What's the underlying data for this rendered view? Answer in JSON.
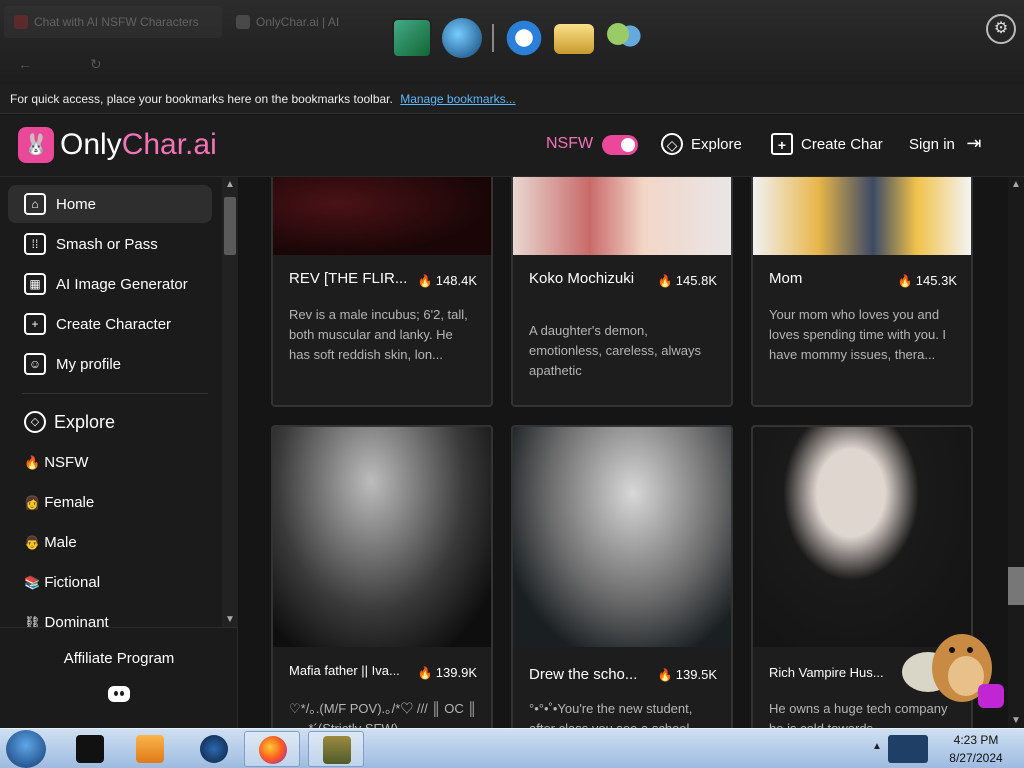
{
  "browser": {
    "tabs": [
      {
        "label": "Chat with AI NSFW Characters"
      },
      {
        "label": "OnlyChar.ai | AI"
      }
    ],
    "bookmarks_bar": {
      "text": "For quick access, place your bookmarks here on the bookmarks toolbar.",
      "link": "Manage bookmarks..."
    }
  },
  "header": {
    "logo_prefix": "Only",
    "logo_accent": "Char.ai",
    "nsfw_label": "NSFW",
    "nsfw_enabled": true,
    "explore": "Explore",
    "create_char": "Create Char",
    "sign_in": "Sign in"
  },
  "sidebar": {
    "items": [
      {
        "label": "Home",
        "icon": "home-icon"
      },
      {
        "label": "Smash or Pass",
        "icon": "grid-icon"
      },
      {
        "label": "AI Image Generator",
        "icon": "image-icon"
      },
      {
        "label": "Create Character",
        "icon": "plus-icon"
      },
      {
        "label": "My profile",
        "icon": "user-icon"
      }
    ],
    "explore_title": "Explore",
    "categories": [
      {
        "emoji": "🔥",
        "label": "NSFW"
      },
      {
        "emoji": "👩",
        "label": "Female"
      },
      {
        "emoji": "👨",
        "label": "Male"
      },
      {
        "emoji": "📚",
        "label": "Fictional"
      },
      {
        "emoji": "⛓",
        "label": "Dominant"
      }
    ],
    "affiliate": "Affiliate Program"
  },
  "cards": [
    {
      "title": "REV [THE FLIR...",
      "count": "148.4K",
      "desc": "Rev is a male incubus; 6'2, tall, both muscular and lanky. He has soft reddish skin, lon..."
    },
    {
      "title": "Koko Mochizuki",
      "count": "145.8K",
      "desc": "A daughter's demon, emotionless, careless, always apathetic"
    },
    {
      "title": "Mom",
      "count": "145.3K",
      "desc": "Your mom who loves you and loves spending time with you. I have mommy issues, thera..."
    },
    {
      "title": "Mafia father || Iva...",
      "count": "139.9K",
      "desc": "♡*/｡.(M/F POV).｡/*♡ /// ║ OC ║ - ..-*´(Strictly SFW)"
    },
    {
      "title": "Drew the scho...",
      "count": "139.5K",
      "desc": "°•°•˚•You're the new student, after class you see a school"
    },
    {
      "title": "Rich Vampire Hus...",
      "count": "",
      "desc": "He owns a huge tech company he is cold towards"
    }
  ],
  "taskbar": {
    "time": "4:23 PM",
    "date": "8/27/2024"
  }
}
